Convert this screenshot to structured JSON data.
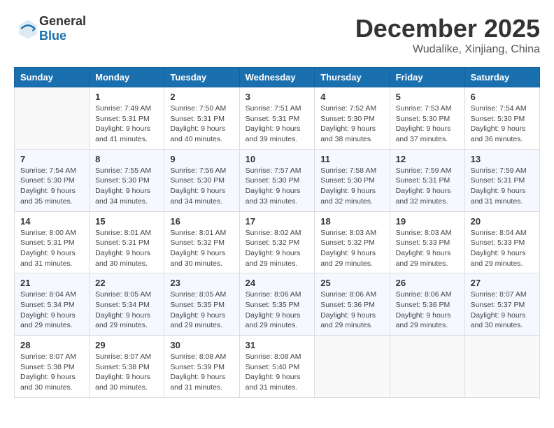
{
  "header": {
    "logo_general": "General",
    "logo_blue": "Blue",
    "month": "December 2025",
    "location": "Wudalike, Xinjiang, China"
  },
  "days_of_week": [
    "Sunday",
    "Monday",
    "Tuesday",
    "Wednesday",
    "Thursday",
    "Friday",
    "Saturday"
  ],
  "weeks": [
    [
      {
        "day": "",
        "info": ""
      },
      {
        "day": "1",
        "info": "Sunrise: 7:49 AM\nSunset: 5:31 PM\nDaylight: 9 hours\nand 41 minutes."
      },
      {
        "day": "2",
        "info": "Sunrise: 7:50 AM\nSunset: 5:31 PM\nDaylight: 9 hours\nand 40 minutes."
      },
      {
        "day": "3",
        "info": "Sunrise: 7:51 AM\nSunset: 5:31 PM\nDaylight: 9 hours\nand 39 minutes."
      },
      {
        "day": "4",
        "info": "Sunrise: 7:52 AM\nSunset: 5:30 PM\nDaylight: 9 hours\nand 38 minutes."
      },
      {
        "day": "5",
        "info": "Sunrise: 7:53 AM\nSunset: 5:30 PM\nDaylight: 9 hours\nand 37 minutes."
      },
      {
        "day": "6",
        "info": "Sunrise: 7:54 AM\nSunset: 5:30 PM\nDaylight: 9 hours\nand 36 minutes."
      }
    ],
    [
      {
        "day": "7",
        "info": "Sunrise: 7:54 AM\nSunset: 5:30 PM\nDaylight: 9 hours\nand 35 minutes."
      },
      {
        "day": "8",
        "info": "Sunrise: 7:55 AM\nSunset: 5:30 PM\nDaylight: 9 hours\nand 34 minutes."
      },
      {
        "day": "9",
        "info": "Sunrise: 7:56 AM\nSunset: 5:30 PM\nDaylight: 9 hours\nand 34 minutes."
      },
      {
        "day": "10",
        "info": "Sunrise: 7:57 AM\nSunset: 5:30 PM\nDaylight: 9 hours\nand 33 minutes."
      },
      {
        "day": "11",
        "info": "Sunrise: 7:58 AM\nSunset: 5:30 PM\nDaylight: 9 hours\nand 32 minutes."
      },
      {
        "day": "12",
        "info": "Sunrise: 7:59 AM\nSunset: 5:31 PM\nDaylight: 9 hours\nand 32 minutes."
      },
      {
        "day": "13",
        "info": "Sunrise: 7:59 AM\nSunset: 5:31 PM\nDaylight: 9 hours\nand 31 minutes."
      }
    ],
    [
      {
        "day": "14",
        "info": "Sunrise: 8:00 AM\nSunset: 5:31 PM\nDaylight: 9 hours\nand 31 minutes."
      },
      {
        "day": "15",
        "info": "Sunrise: 8:01 AM\nSunset: 5:31 PM\nDaylight: 9 hours\nand 30 minutes."
      },
      {
        "day": "16",
        "info": "Sunrise: 8:01 AM\nSunset: 5:32 PM\nDaylight: 9 hours\nand 30 minutes."
      },
      {
        "day": "17",
        "info": "Sunrise: 8:02 AM\nSunset: 5:32 PM\nDaylight: 9 hours\nand 29 minutes."
      },
      {
        "day": "18",
        "info": "Sunrise: 8:03 AM\nSunset: 5:32 PM\nDaylight: 9 hours\nand 29 minutes."
      },
      {
        "day": "19",
        "info": "Sunrise: 8:03 AM\nSunset: 5:33 PM\nDaylight: 9 hours\nand 29 minutes."
      },
      {
        "day": "20",
        "info": "Sunrise: 8:04 AM\nSunset: 5:33 PM\nDaylight: 9 hours\nand 29 minutes."
      }
    ],
    [
      {
        "day": "21",
        "info": "Sunrise: 8:04 AM\nSunset: 5:34 PM\nDaylight: 9 hours\nand 29 minutes."
      },
      {
        "day": "22",
        "info": "Sunrise: 8:05 AM\nSunset: 5:34 PM\nDaylight: 9 hours\nand 29 minutes."
      },
      {
        "day": "23",
        "info": "Sunrise: 8:05 AM\nSunset: 5:35 PM\nDaylight: 9 hours\nand 29 minutes."
      },
      {
        "day": "24",
        "info": "Sunrise: 8:06 AM\nSunset: 5:35 PM\nDaylight: 9 hours\nand 29 minutes."
      },
      {
        "day": "25",
        "info": "Sunrise: 8:06 AM\nSunset: 5:36 PM\nDaylight: 9 hours\nand 29 minutes."
      },
      {
        "day": "26",
        "info": "Sunrise: 8:06 AM\nSunset: 5:36 PM\nDaylight: 9 hours\nand 29 minutes."
      },
      {
        "day": "27",
        "info": "Sunrise: 8:07 AM\nSunset: 5:37 PM\nDaylight: 9 hours\nand 30 minutes."
      }
    ],
    [
      {
        "day": "28",
        "info": "Sunrise: 8:07 AM\nSunset: 5:38 PM\nDaylight: 9 hours\nand 30 minutes."
      },
      {
        "day": "29",
        "info": "Sunrise: 8:07 AM\nSunset: 5:38 PM\nDaylight: 9 hours\nand 30 minutes."
      },
      {
        "day": "30",
        "info": "Sunrise: 8:08 AM\nSunset: 5:39 PM\nDaylight: 9 hours\nand 31 minutes."
      },
      {
        "day": "31",
        "info": "Sunrise: 8:08 AM\nSunset: 5:40 PM\nDaylight: 9 hours\nand 31 minutes."
      },
      {
        "day": "",
        "info": ""
      },
      {
        "day": "",
        "info": ""
      },
      {
        "day": "",
        "info": ""
      }
    ]
  ]
}
